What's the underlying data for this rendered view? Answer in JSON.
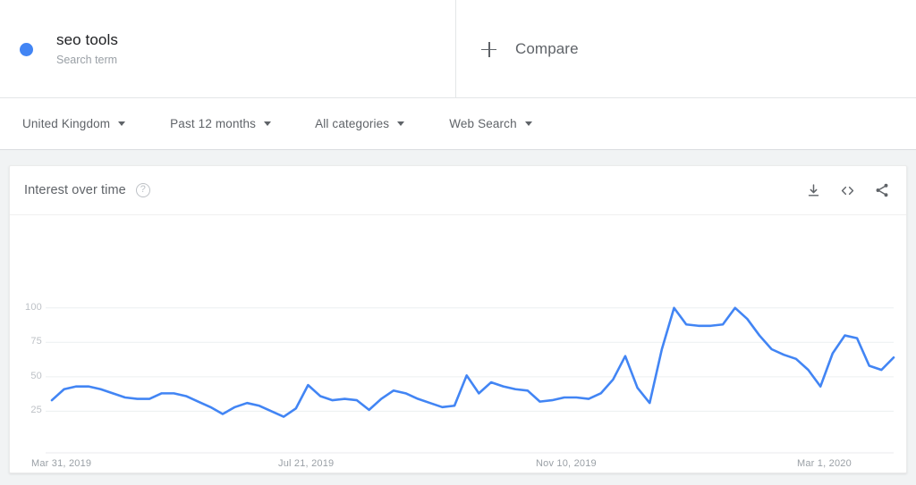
{
  "term_bar": {
    "term": {
      "title": "seo tools",
      "subtitle": "Search term",
      "dot_color": "#4285f4"
    },
    "compare": {
      "label": "Compare",
      "icon": "plus-icon"
    }
  },
  "filters": [
    {
      "label": "United Kingdom",
      "icon": "chevron-down-icon"
    },
    {
      "label": "Past 12 months",
      "icon": "chevron-down-icon"
    },
    {
      "label": "All categories",
      "icon": "chevron-down-icon"
    },
    {
      "label": "Web Search",
      "icon": "chevron-down-icon"
    }
  ],
  "card": {
    "title": "Interest over time",
    "help_icon": "?",
    "actions": [
      {
        "name": "download-icon",
        "tooltip": "Download"
      },
      {
        "name": "embed-code-icon",
        "tooltip": "Embed"
      },
      {
        "name": "share-icon",
        "tooltip": "Share"
      }
    ]
  },
  "chart_data": {
    "type": "line",
    "title": "Interest over time",
    "xlabel": "",
    "ylabel": "",
    "grid": true,
    "legend": false,
    "line_color": "#4285f4",
    "ylim": [
      0,
      105
    ],
    "yticks": [
      25,
      50,
      75,
      100
    ],
    "ytick_labels": [
      "25",
      "50",
      "75",
      "100"
    ],
    "xtick_labels": [
      "Mar 31, 2019",
      "Jul 21, 2019",
      "Nov 10, 2019",
      "Mar 1, 2020"
    ],
    "xtick_indices": [
      0,
      16,
      32,
      48
    ],
    "series": [
      {
        "name": "seo tools",
        "values": [
          33,
          41,
          43,
          43,
          41,
          38,
          35,
          34,
          34,
          38,
          38,
          36,
          32,
          28,
          23,
          28,
          31,
          29,
          25,
          21,
          27,
          44,
          36,
          33,
          34,
          33,
          26,
          34,
          40,
          38,
          34,
          31,
          28,
          29,
          51,
          38,
          46,
          43,
          41,
          40,
          32,
          33,
          35,
          35,
          34,
          38,
          48,
          65,
          42,
          31,
          70,
          100,
          88,
          87,
          87,
          88,
          100,
          92,
          80,
          70,
          66,
          63,
          55,
          43,
          67,
          80,
          78,
          58,
          55,
          64
        ]
      }
    ]
  }
}
